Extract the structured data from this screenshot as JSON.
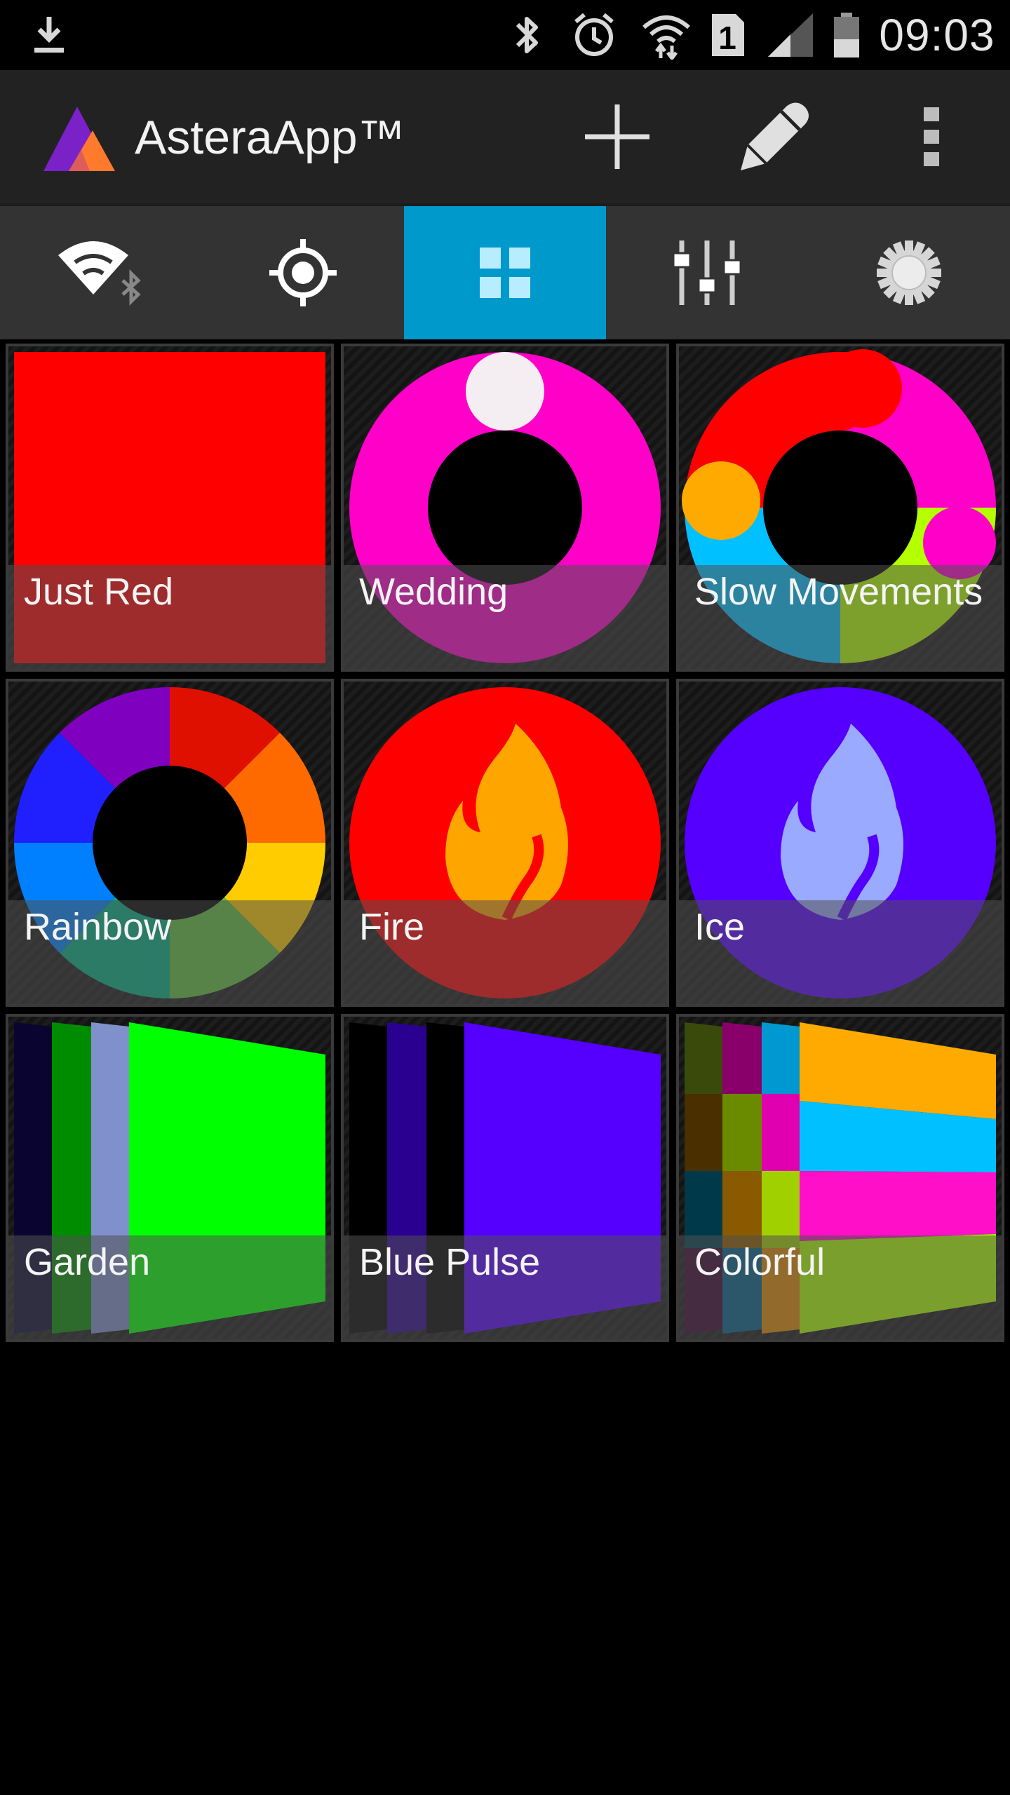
{
  "status_bar": {
    "time": "09:03",
    "sim_slot": "1",
    "icons": [
      "download-icon",
      "bluetooth-icon",
      "alarm-icon",
      "wifi-icon",
      "sim-icon",
      "signal-icon",
      "battery-icon"
    ]
  },
  "action_bar": {
    "title": "AsteraApp™",
    "actions": [
      "add-icon",
      "edit-icon",
      "overflow-menu-icon"
    ]
  },
  "tabs": [
    {
      "icon": "wifi-bluetooth-icon",
      "active": false
    },
    {
      "icon": "target-icon",
      "active": false
    },
    {
      "icon": "grid-icon",
      "active": true
    },
    {
      "icon": "sliders-icon",
      "active": false
    },
    {
      "icon": "settings-icon",
      "active": false
    }
  ],
  "presets": [
    {
      "label": "Just Red"
    },
    {
      "label": "Wedding"
    },
    {
      "label": "Slow Movements"
    },
    {
      "label": "Rainbow"
    },
    {
      "label": "Fire"
    },
    {
      "label": "Ice"
    },
    {
      "label": "Garden"
    },
    {
      "label": "Blue Pulse"
    },
    {
      "label": "Colorful"
    }
  ],
  "colors": {
    "accent": "#0099cc",
    "action_bar": "#222222",
    "tab_bar": "#333333",
    "red": "#ff0000",
    "magenta": "#ff00c8",
    "violet": "#5500ff",
    "green": "#00ff00",
    "orange": "#ffaa00"
  }
}
